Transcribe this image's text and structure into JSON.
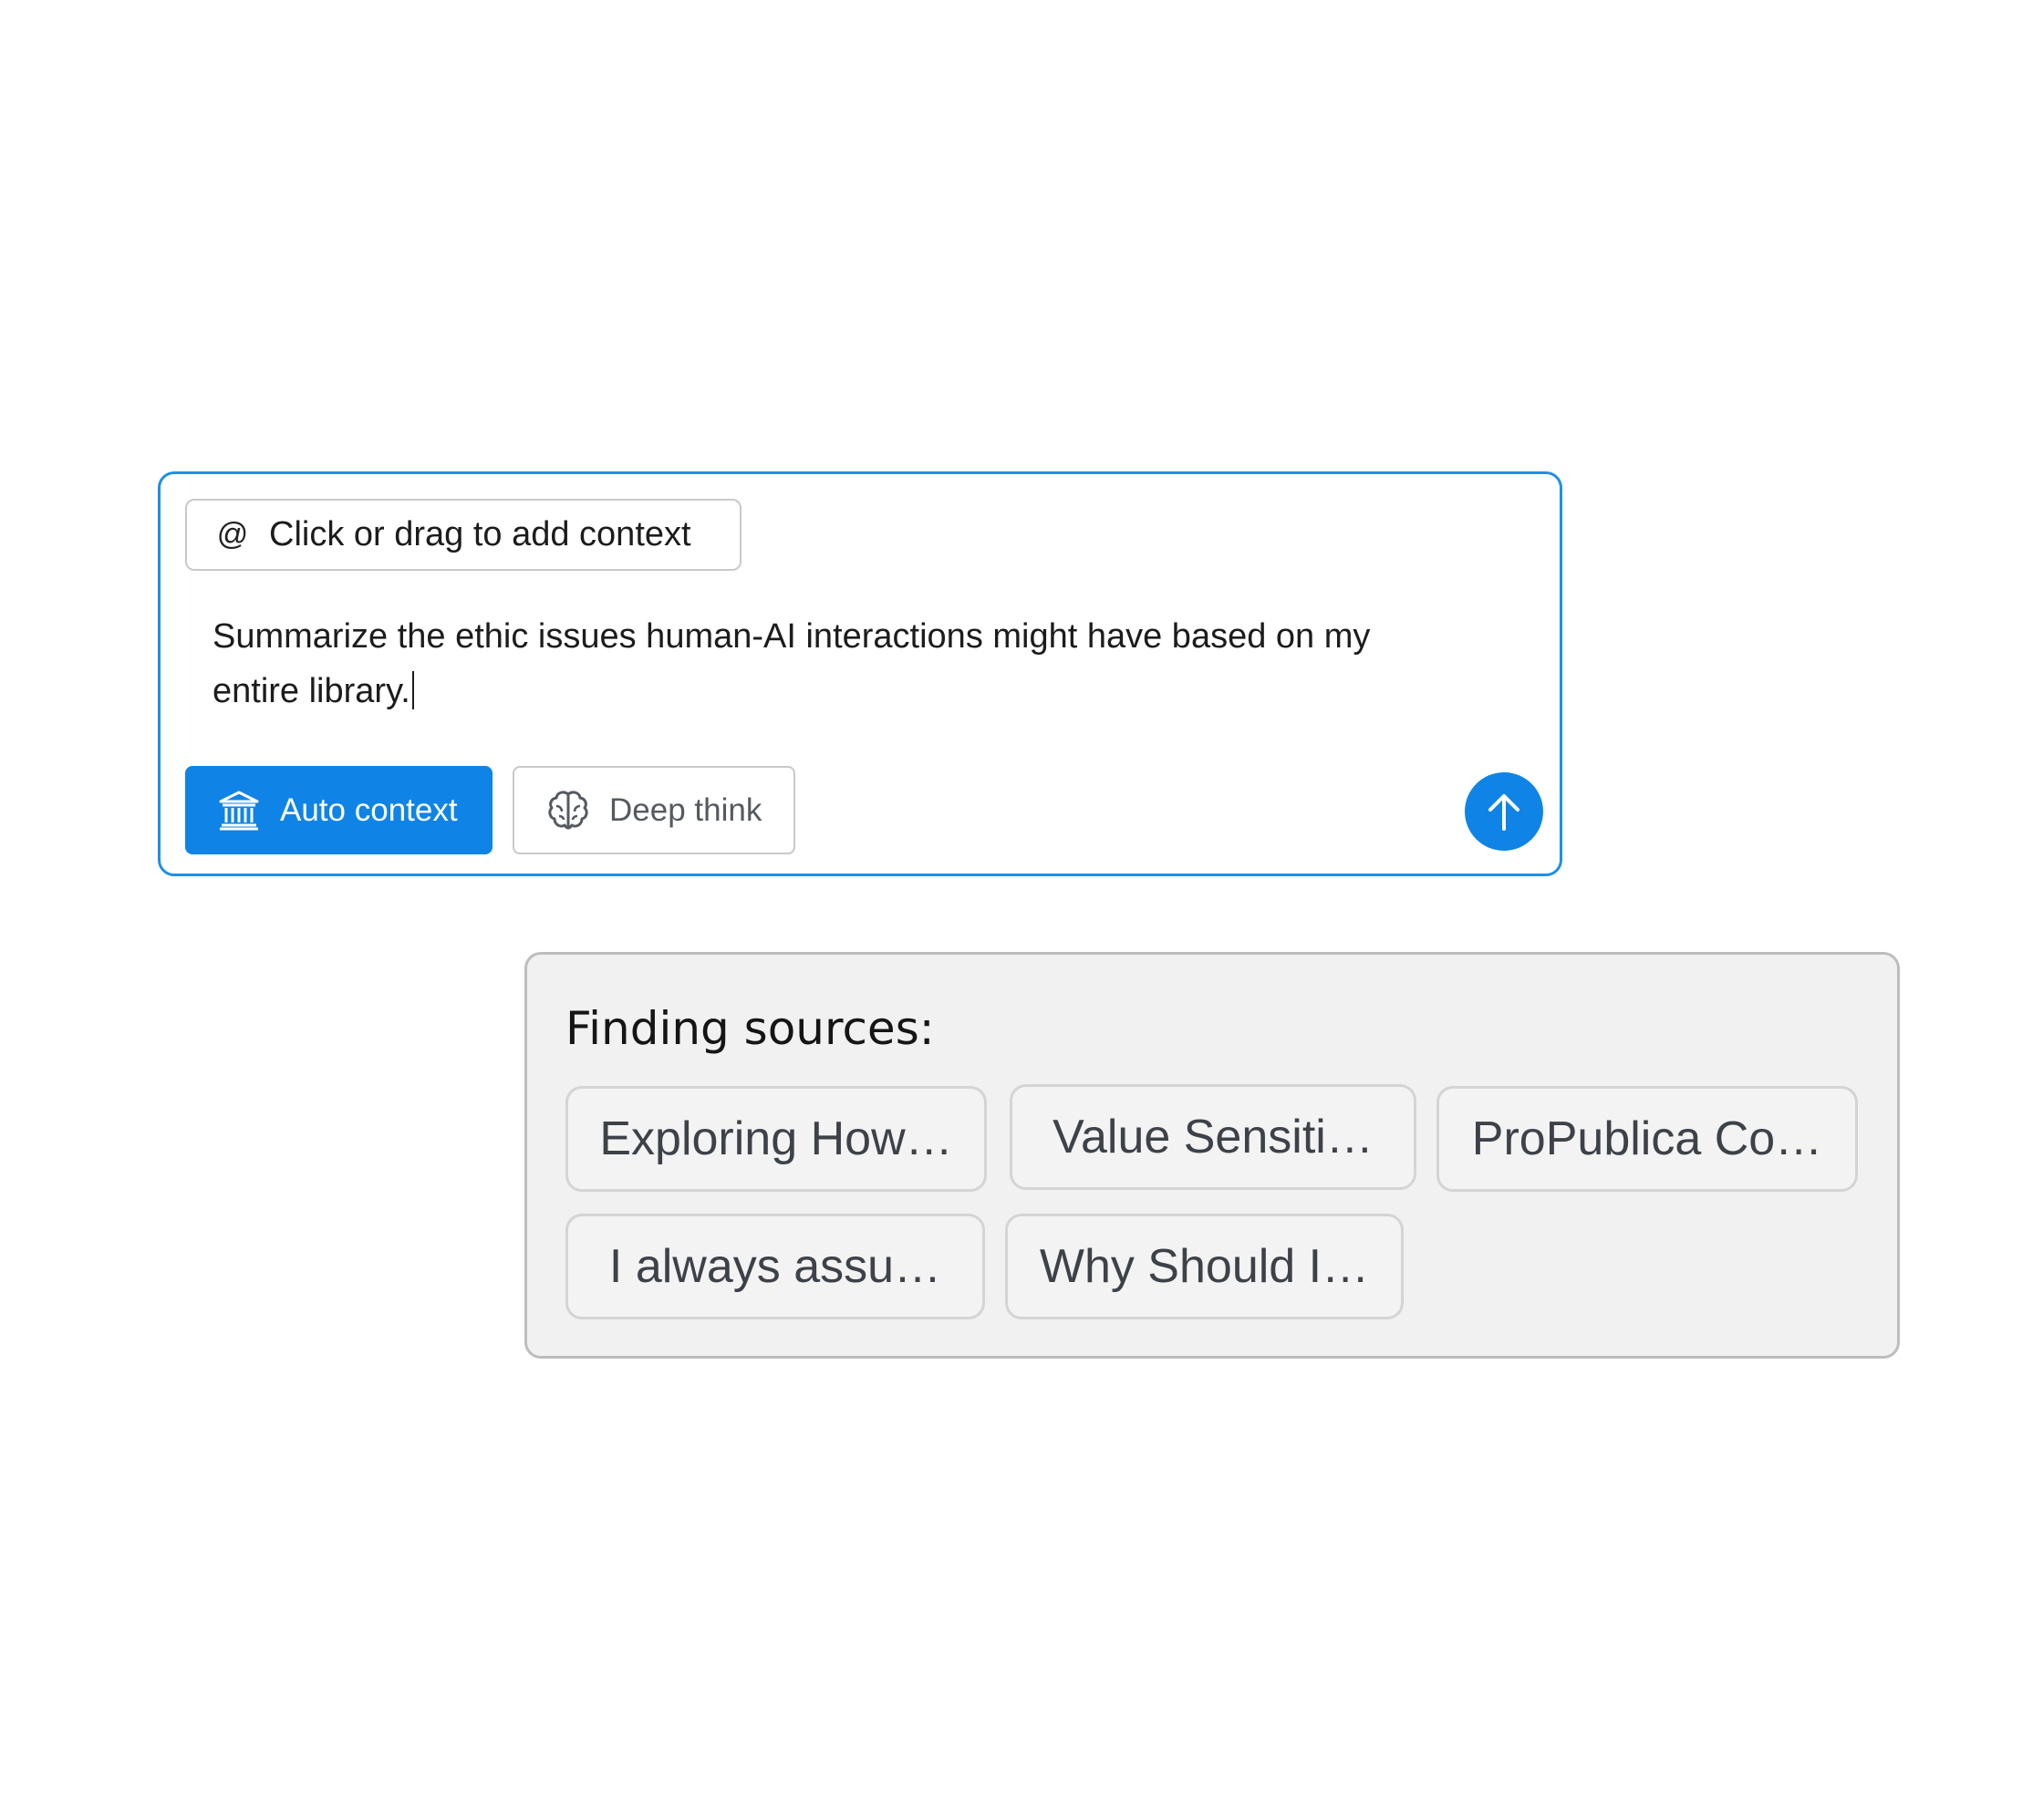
{
  "composer": {
    "context_chip": {
      "icon": "at-sign-icon",
      "icon_glyph": "@",
      "label": "Click or drag to add context"
    },
    "prompt": {
      "line1": "Summarize the ethic issues human-AI interactions might have based on my",
      "line2": "entire library."
    },
    "auto_context_button": {
      "icon": "bank-icon",
      "label": "Auto context",
      "active": true
    },
    "deep_think_button": {
      "icon": "brain-icon",
      "label": "Deep think",
      "active": false
    },
    "send_button": {
      "icon": "arrow-up-icon"
    },
    "colors": {
      "accent": "#0f84e6",
      "border": "#1e90e6"
    }
  },
  "sources_panel": {
    "title": "Finding sources:",
    "sources": [
      {
        "label": "Exploring How…"
      },
      {
        "label": "Value Sensiti…"
      },
      {
        "label": "ProPublica Co…"
      },
      {
        "label": "I always assu…"
      },
      {
        "label": "Why Should I…"
      }
    ]
  }
}
